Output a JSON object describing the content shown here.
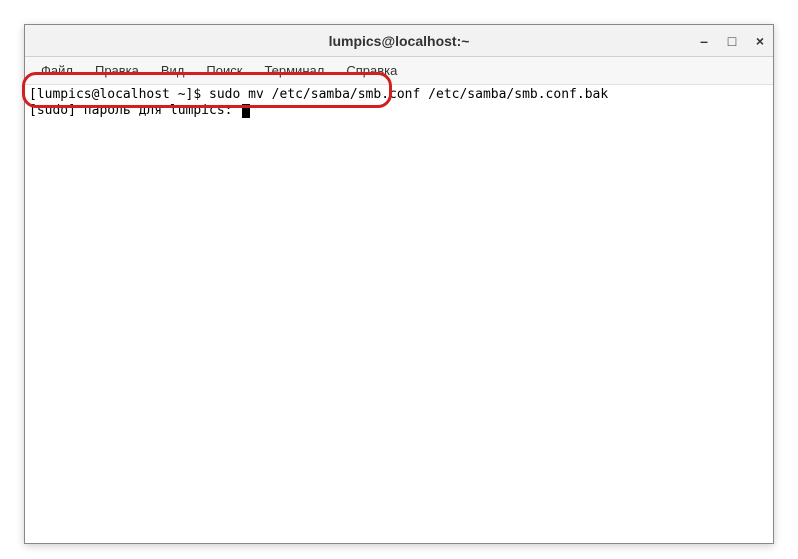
{
  "window": {
    "title": "lumpics@localhost:~"
  },
  "controls": {
    "minimize": "–",
    "maximize": "□",
    "close": "×"
  },
  "menu": {
    "file": "Файл",
    "edit": "Правка",
    "view": "Вид",
    "search": "Поиск",
    "terminal": "Терминал",
    "help": "Справка"
  },
  "terminal": {
    "line1": "[lumpics@localhost ~]$ sudo mv /etc/samba/smb.conf /etc/samba/smb.conf.bak",
    "line2": "[sudo] пароль для lumpics: "
  }
}
